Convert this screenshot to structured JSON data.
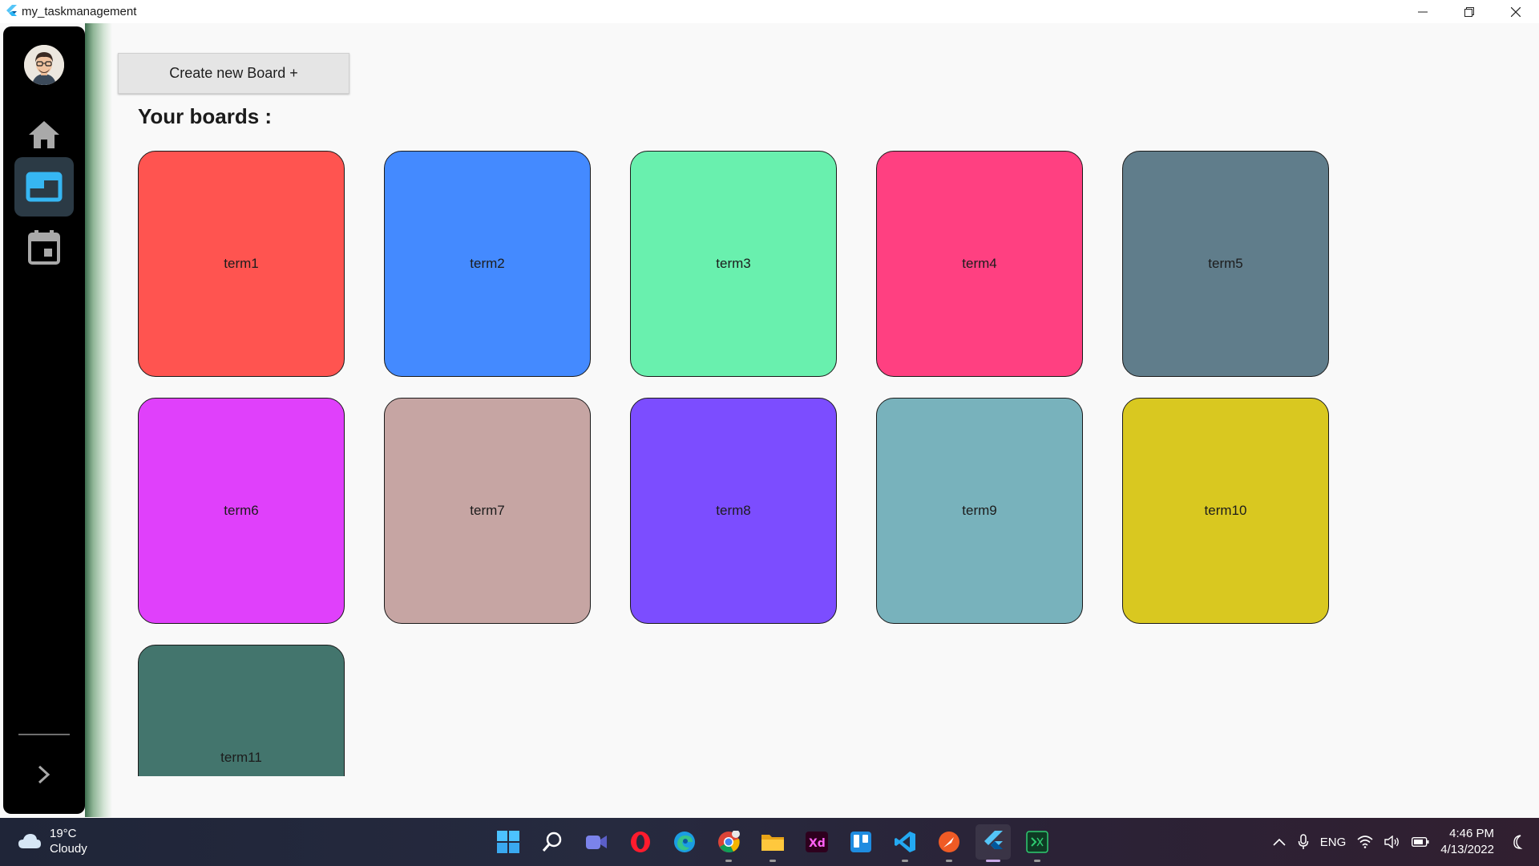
{
  "window": {
    "title": "my_taskmanagement"
  },
  "sidebar": {
    "items": [
      {
        "icon": "home-icon",
        "active": false
      },
      {
        "icon": "board-icon",
        "active": true
      },
      {
        "icon": "calendar-icon",
        "active": false
      }
    ]
  },
  "main": {
    "create_button_label": "Create new Board +",
    "heading": "Your boards :",
    "boards": [
      {
        "name": "term1",
        "color": "#ff5450"
      },
      {
        "name": "term2",
        "color": "#448aff"
      },
      {
        "name": "term3",
        "color": "#69f0ae"
      },
      {
        "name": "term4",
        "color": "#ff4081"
      },
      {
        "name": "term5",
        "color": "#607d8b"
      },
      {
        "name": "term6",
        "color": "#e040fb"
      },
      {
        "name": "term7",
        "color": "#c6a5a3"
      },
      {
        "name": "term8",
        "color": "#7c4dff"
      },
      {
        "name": "term9",
        "color": "#78b2bc"
      },
      {
        "name": "term10",
        "color": "#d9c820"
      },
      {
        "name": "term11",
        "color": "#43756d"
      }
    ]
  },
  "taskbar": {
    "weather": {
      "temp": "19°C",
      "condition": "Cloudy"
    },
    "apps": [
      "start-icon",
      "search-icon",
      "teams-icon",
      "opera-icon",
      "edge-icon",
      "chrome-icon",
      "file-explorer-icon",
      "adobe-xd-icon",
      "trello-icon",
      "vscode-icon",
      "postman-icon",
      "flutter-icon",
      "terminal-icon"
    ],
    "language": "ENG",
    "time": "4:46 PM",
    "date": "4/13/2022"
  }
}
